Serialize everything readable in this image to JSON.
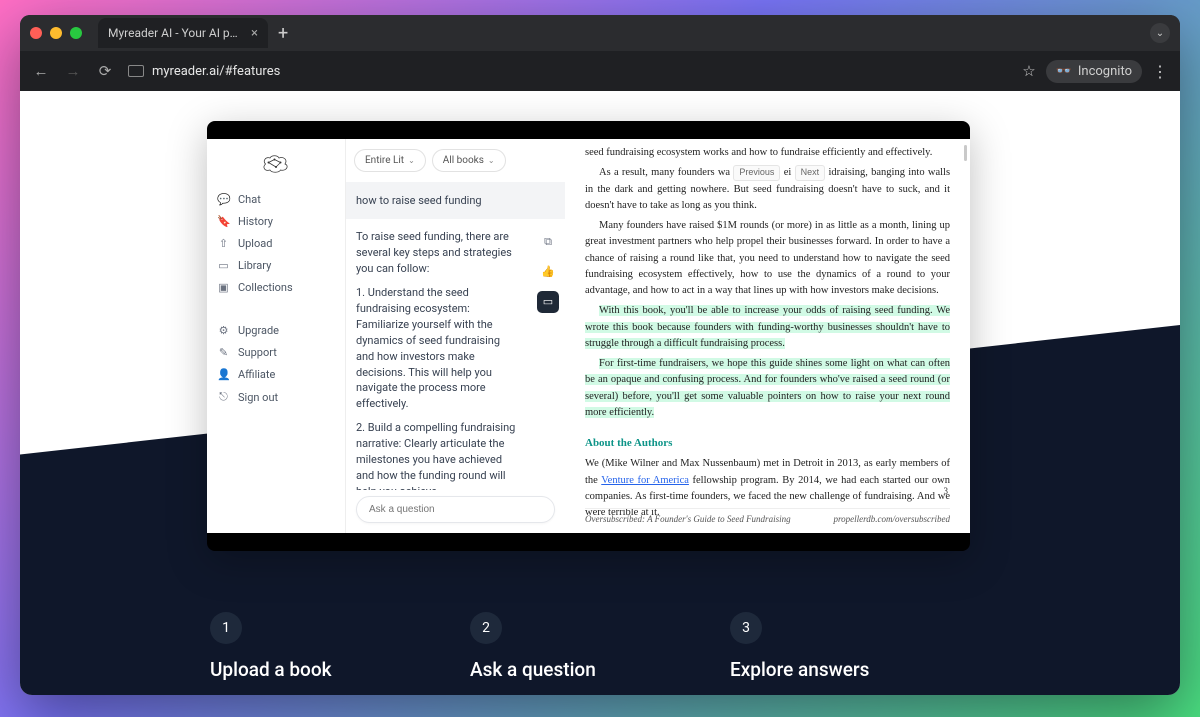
{
  "browser": {
    "tab_title": "Myreader AI - Your AI powere",
    "url": "myreader.ai/#features",
    "incognito_label": "Incognito"
  },
  "sidebar": {
    "items": [
      {
        "label": "Chat"
      },
      {
        "label": "History"
      },
      {
        "label": "Upload"
      },
      {
        "label": "Library"
      },
      {
        "label": "Collections"
      }
    ],
    "bottom_items": [
      {
        "label": "Upgrade"
      },
      {
        "label": "Support"
      },
      {
        "label": "Affiliate"
      },
      {
        "label": "Sign out"
      }
    ]
  },
  "chat": {
    "dropdown1": "Entire Lit",
    "dropdown2": "All books",
    "query": "how to raise seed funding",
    "answer_p1": "To raise seed funding, there are several key steps and strategies you can follow:",
    "answer_p2": "1. Understand the seed fundraising ecosystem: Familiarize yourself with the dynamics of seed fundraising and how investors make decisions. This will help you navigate the process more effectively.",
    "answer_p3": "2. Build a compelling fundraising narrative: Clearly articulate the milestones you have achieved and how the funding round will help you achieve",
    "ask_placeholder": "Ask a question"
  },
  "doc": {
    "p1": "seed fundraising ecosystem works and how to fundraise efficiently and effectively.",
    "p2a": "As a result, many founders wa",
    "nav_prev": "Previous",
    "p2b": "ei",
    "nav_next": "Next",
    "p2c": "idraising, banging into walls in the dark and getting nowhere. But seed fundraising doesn't have to suck, and it doesn't have to take as long as you think.",
    "p3": "Many founders have raised $1M rounds (or more) in as little as a month, lining up great investment partners who help propel their businesses forward. In order to have a chance of raising a round like that, you need to understand how to navigate the seed fundraising ecosystem effectively, how to use the dynamics of a round to your advantage, and how to act in a way that lines up with how investors make decisions.",
    "p4": "With this book, you'll be able to increase your odds of raising seed funding. We wrote this book because founders with funding-worthy businesses shouldn't have to struggle through a difficult fundraising process.",
    "p5": "For first-time fundraisers, we hope this guide shines some light on what can often be an opaque and confusing process. And for founders who've raised a seed round (or several) before, you'll get some valuable pointers on how to raise your next round more efficiently.",
    "about_heading": "About the Authors",
    "about_p_a": "We (Mike Wilner and Max Nussenbaum) met in Detroit in 2013, as early members of the ",
    "about_link": "Venture for America",
    "about_p_b": " fellowship program. By 2014, we had each started our own companies. As first-time founders, we faced the new challenge of fundraising. And we were terrible at it.",
    "page_number": "3",
    "footer_left": "Oversubscribed: A Founder's Guide to Seed Fundraising",
    "footer_right": "propellerdb.com/oversubscribed"
  },
  "features": {
    "step1_num": "1",
    "step1_title": "Upload a book",
    "step2_num": "2",
    "step2_title": "Ask a question",
    "step3_num": "3",
    "step3_title": "Explore answers"
  }
}
